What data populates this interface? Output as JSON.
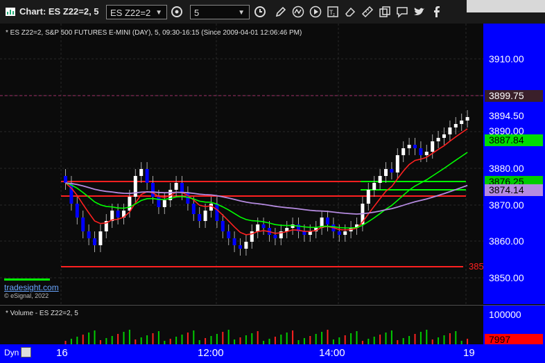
{
  "window": {
    "title": "Chart: ES Z22=2, 5"
  },
  "toolbar": {
    "symbol_value": "ES Z22=2",
    "interval_value": "5",
    "tools": [
      "pencil-icon",
      "wave-icon",
      "play-icon",
      "tz-icon",
      "eraser-icon",
      "copy-icon",
      "comment-icon",
      "twitter-icon",
      "facebook-icon"
    ]
  },
  "chart": {
    "header": "* ES Z22=2, S&P 500 FUTURES E-MINI (DAY), 5, 09:30-16:15 (Since 2009-04-01 12:06:46 PM)",
    "watermark": "tradesight.com",
    "copyright": "© eSignal, 2022",
    "price_axis_labels": [
      "3910.00",
      "3880.00",
      "3870.00",
      "3860.00",
      "3850.00"
    ],
    "tags": [
      {
        "text": "3899.75",
        "bg": "#3a1f2a",
        "fg": "#ffffff"
      },
      {
        "text": "3894.50",
        "bg": "#0000ff",
        "fg": "#ffffff"
      },
      {
        "text": "3890.00",
        "bg": "#0000ff",
        "fg": "#ffffff"
      },
      {
        "text": "3887.84",
        "bg": "#00dd00",
        "fg": "#000000"
      },
      {
        "text": "3876.25",
        "bg": "#00cc00",
        "fg": "#000000"
      },
      {
        "text": "3874.14",
        "bg": "#b58be0",
        "fg": "#000000"
      }
    ],
    "red_line_label": "385",
    "colors": {
      "up": "#ffffff",
      "down": "#0000ff",
      "ema_fast": "#ff2020",
      "ema_slow": "#00ff00",
      "vwap": "#b58be0",
      "red_level": "#ff2020",
      "green_level": "#00ff00"
    }
  },
  "volume": {
    "header": "* Volume - ES Z22=2, 5",
    "axis_label": "100000",
    "last_value": "7997",
    "last_bg": "#ff0000"
  },
  "time_axis": {
    "labels": [
      "16",
      "12:00",
      "14:00",
      "19"
    ],
    "dyn_label": "Dyn"
  }
}
